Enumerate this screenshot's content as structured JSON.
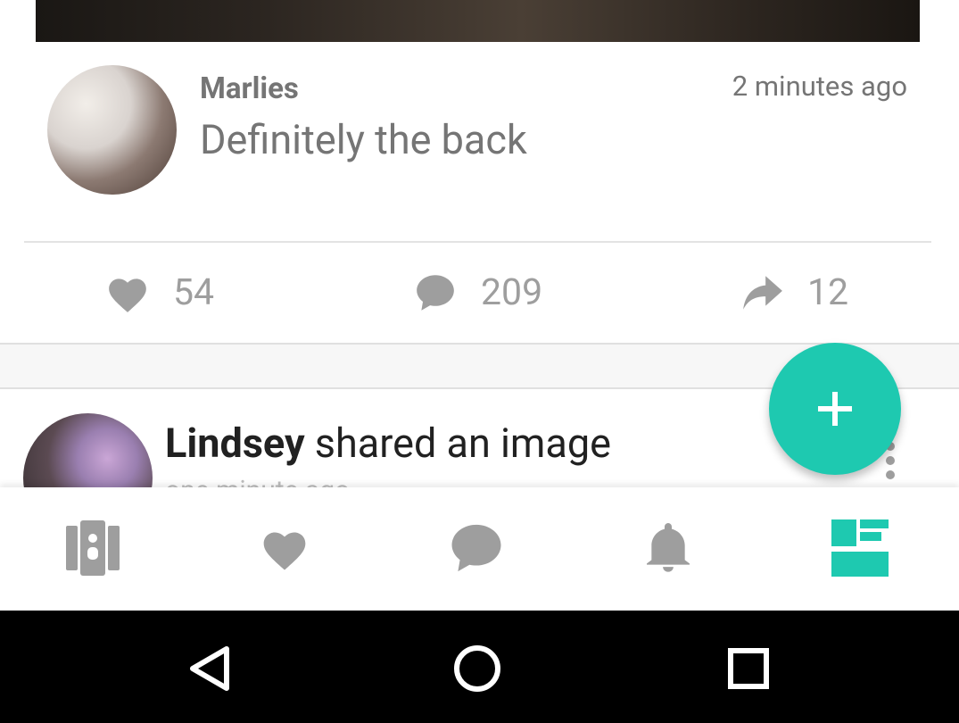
{
  "comment": {
    "author": "Marlies",
    "time": "2 minutes ago",
    "text": "Definitely the back"
  },
  "actions": {
    "likes": "54",
    "comments": "209",
    "shares": "12"
  },
  "next_post": {
    "author": "Lindsey",
    "action_text": " shared an image",
    "time_partial": "one minute ago"
  },
  "icons": {
    "fab": "plus-icon",
    "nav": [
      "contacts-book-icon",
      "heart-icon",
      "chat-bubble-icon",
      "bell-icon",
      "feed-icon"
    ],
    "system": [
      "back-triangle-icon",
      "home-circle-icon",
      "recents-square-icon"
    ]
  },
  "colors": {
    "accent": "#1ec9b0",
    "icon_gray": "#9e9e9e",
    "text_gray": "#757575"
  }
}
